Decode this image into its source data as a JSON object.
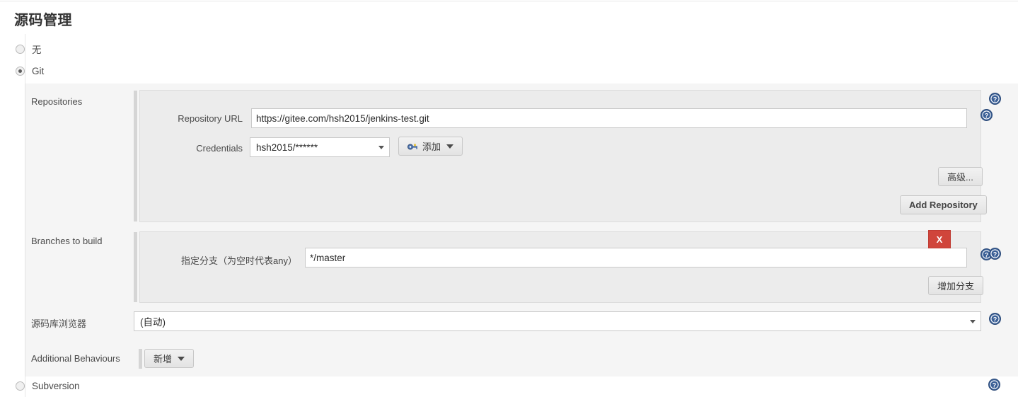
{
  "page": {
    "title": "源码管理"
  },
  "scm_options": [
    {
      "label": "无",
      "selected": false,
      "name": "none"
    },
    {
      "label": "Git",
      "selected": true,
      "name": "git"
    },
    {
      "label": "Subversion",
      "selected": false,
      "name": "subversion"
    }
  ],
  "git": {
    "repositories": {
      "label": "Repositories",
      "repository_url": {
        "label": "Repository URL",
        "value": "https://gitee.com/hsh2015/jenkins-test.git",
        "placeholder": ""
      },
      "credentials": {
        "label": "Credentials",
        "value": "hsh2015/******",
        "add_button": "添加",
        "add_icon": "key-icon"
      },
      "advanced_button": "高级...",
      "add_repository_button": "Add Repository"
    },
    "branches": {
      "label": "Branches to build",
      "branch_specifier": {
        "label": "指定分支（为空时代表any）",
        "value": "*/master",
        "placeholder": ""
      },
      "delete_button": "X",
      "add_branch_button": "增加分支"
    },
    "repository_browser": {
      "label": "源码库浏览器",
      "value": "(自动)"
    },
    "additional_behaviours": {
      "label": "Additional Behaviours",
      "add_button": "新增"
    }
  },
  "help": {
    "icon": "help-icon",
    "tooltip": "?"
  },
  "colors": {
    "body_bg": "#ffffff",
    "section_bg": "#f5f5f5",
    "panel_bg": "#ececec",
    "panel_border": "#dcdcdc",
    "danger": "#d0453b",
    "help_blue": "#3a5f96",
    "text": "#333333"
  }
}
